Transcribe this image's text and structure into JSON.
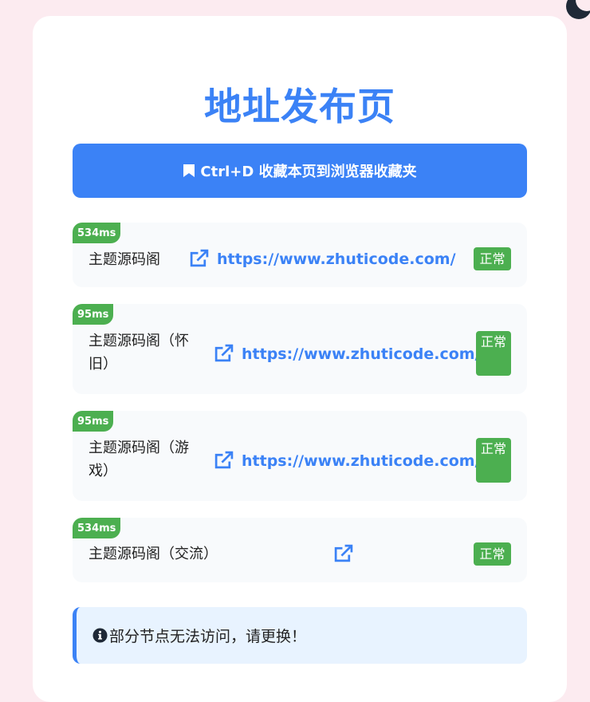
{
  "page": {
    "title": "地址发布页",
    "bookmark_label": "Ctrl+D 收藏本页到浏览器收藏夹",
    "notice": "部分节点无法访问，请更换！"
  },
  "links": [
    {
      "latency": "534ms",
      "name": "主题源码阁",
      "url": "https://www.zhuticode.com/",
      "status": "正常"
    },
    {
      "latency": "95ms",
      "name": "主题源码阁（怀旧）",
      "url": "https://www.zhuticode.com/",
      "status": "正常"
    },
    {
      "latency": "95ms",
      "name": "主题源码阁（游戏）",
      "url": "https://www.zhuticode.com/",
      "status": "正常"
    },
    {
      "latency": "534ms",
      "name": "主题源码阁（交流）",
      "url": "",
      "status": "正常"
    }
  ],
  "icons": {
    "theme_toggle": "moon-icon",
    "bookmark": "bookmark-icon",
    "external_link": "external-link-icon",
    "notice": "info-circle-icon"
  },
  "colors": {
    "accent": "#3b82f6",
    "status_ok": "#4caf50",
    "background": "#fcebf0",
    "notice_bg": "#e8f3ff"
  }
}
